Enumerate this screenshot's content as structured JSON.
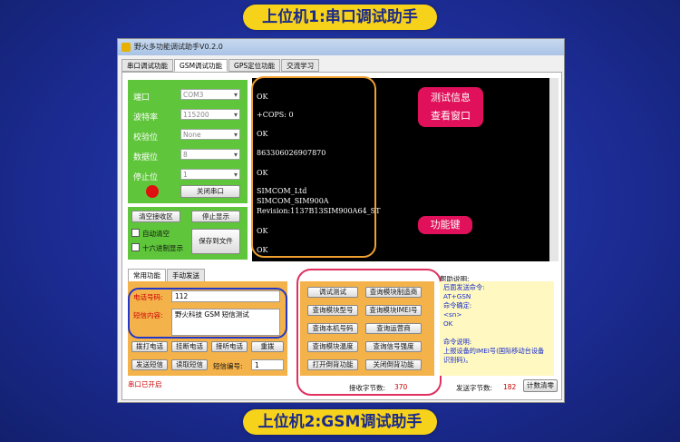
{
  "banners": {
    "top": "上位机1:串口调试助手",
    "bottom": "上位机2:GSM调试助手"
  },
  "window": {
    "title": "野火多功能调试助手V0.2.0"
  },
  "tabs": [
    "串口调试功能",
    "GSM调试功能",
    "GPS定位功能",
    "交流学习"
  ],
  "serial": {
    "port_label": "端口",
    "port_value": "COM3",
    "baud_label": "波特率",
    "baud_value": "115200",
    "parity_label": "校验位",
    "parity_value": "None",
    "data_label": "数据位",
    "data_value": "8",
    "stop_label": "停止位",
    "stop_value": "1",
    "close_btn": "关闭串口"
  },
  "recv": {
    "clear_btn": "清空接收区",
    "stop_btn": "停止显示",
    "auto_clear": "自动清空",
    "hex_display": "十六进制显示",
    "save_btn": "保存到文件"
  },
  "terminal": {
    "lines": [
      "OK",
      "+COPS: 0",
      "OK",
      "863306026907870",
      "OK",
      "SIMCOM_Ltd",
      "SIMCOM_SIM900A",
      "Revision:1137B13SIM900A64_ST",
      "OK",
      "OK"
    ]
  },
  "callouts": {
    "info": "测试信息\n查看窗口",
    "func": "功能键"
  },
  "bottom_tabs": [
    "常用功能",
    "手动发送"
  ],
  "sms": {
    "phone_label": "电话号码:",
    "phone_value": "112",
    "content_label": "短信内容:",
    "content_value": "野火科技 GSM 短信测试",
    "dial_btn": "拨打电话",
    "hangup_btn": "挂断电话",
    "answer_btn": "接听电话",
    "redial_btn": "重拨",
    "send_btn": "发送短信",
    "read_btn": "读取短信",
    "sms_no_label": "短信编号:",
    "sms_no_value": "1"
  },
  "func": {
    "buttons": [
      "调试测试",
      "查询模块制造商",
      "查询模块型号",
      "查询模块IMEI号",
      "查询本机号码",
      "查询运营商",
      "查询模块温度",
      "查询信号强度",
      "打开倒背功能",
      "关闭倒背功能"
    ]
  },
  "help": {
    "title": "帮助说明:",
    "lines": [
      "后面发送命令:",
      "AT+GSN",
      "命令确定:",
      "<sn>",
      "OK",
      "",
      "命令说明:",
      "上报设备的IMEI号(国际移动台设备",
      "识别码)。"
    ]
  },
  "status": {
    "port": "串口已开启",
    "recv_label": "接收字节数:",
    "recv_count": "370",
    "send_label": "发送字节数:",
    "send_count": "182",
    "clear_count_btn": "计数清零"
  }
}
